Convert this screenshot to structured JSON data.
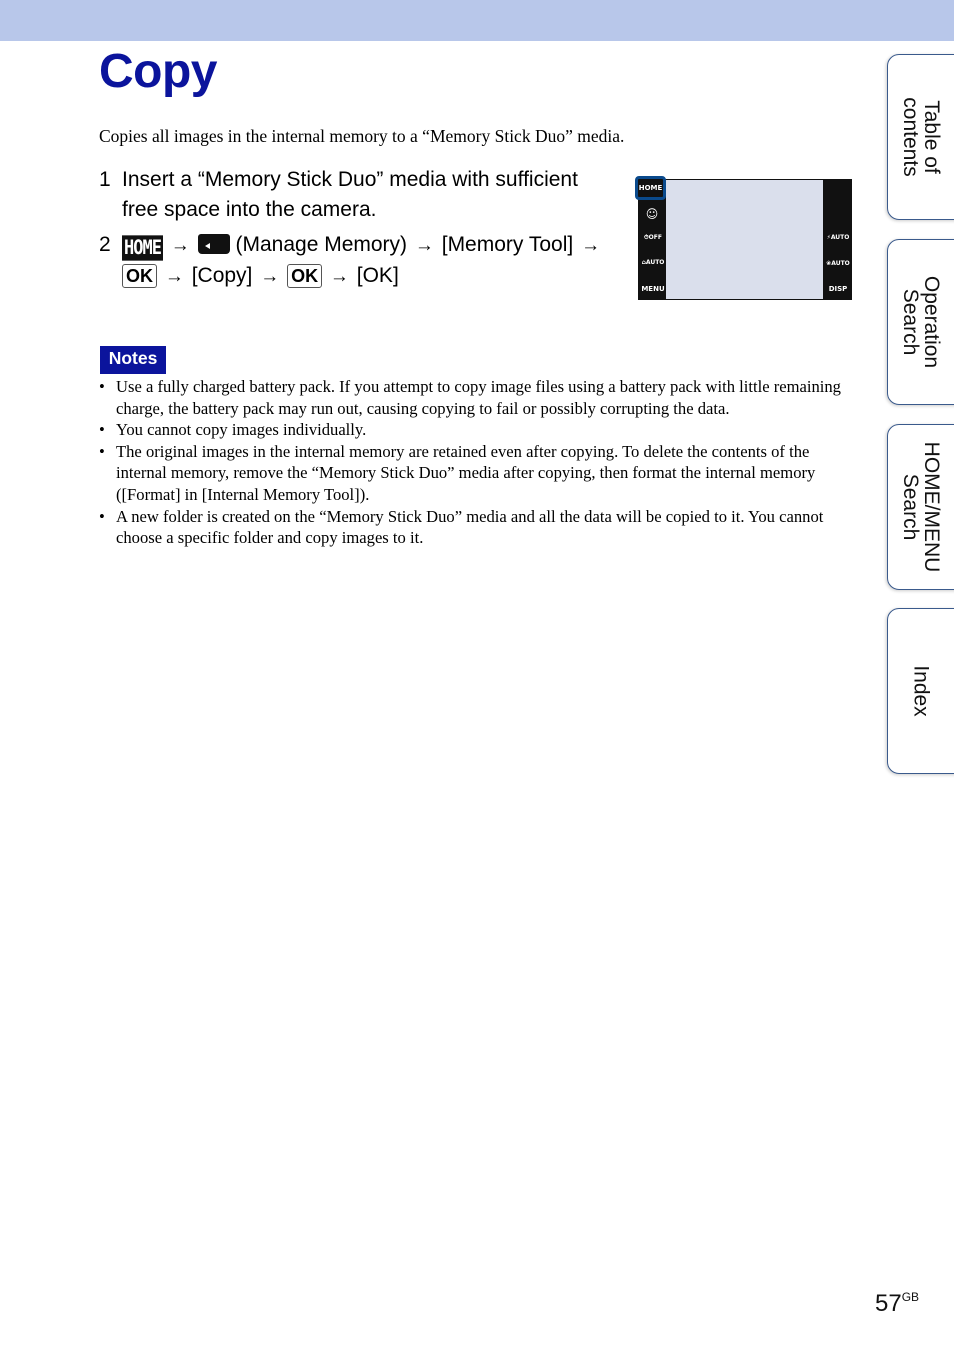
{
  "header": {
    "band_color": "#b8c7ea"
  },
  "page": {
    "title": "Copy",
    "intro": "Copies all images in the internal memory to a “Memory Stick Duo” media.",
    "steps": [
      {
        "number": "1",
        "text": "Insert a “Memory Stick Duo” media with sufficient free space into the camera."
      },
      {
        "number": "2",
        "home_icon": "HOME",
        "arrow": "→",
        "manage_memory_label": "(Manage Memory)",
        "memory_tool": "[Memory Tool]",
        "ok_icon": "OK",
        "copy": "[Copy]",
        "final": "[OK]"
      }
    ],
    "camera_screen": {
      "left_buttons": [
        "HOME",
        "face-icon",
        "self-timer-off-icon",
        "scene-auto-icon",
        "MENU"
      ],
      "left_labels": {
        "home": "HOME",
        "menu": "MENU",
        "timer": "⏱OFF",
        "scene": "⌂AUTO",
        "face": "☺"
      },
      "right_labels": {
        "flash": "⚡AUTO",
        "macro": "❀AUTO",
        "disp": "DISP"
      }
    },
    "notes": {
      "label": "Notes",
      "items": [
        "Use a fully charged battery pack. If you attempt to copy image files using a battery pack with little remaining charge, the battery pack may run out, causing copying to fail or possibly corrupting the data.",
        "You cannot copy images individually.",
        "The original images in the internal memory are retained even after copying. To delete the contents of the internal memory, remove the “Memory Stick Duo” media after copying, then format the internal memory ([Format] in [Internal Memory Tool]).",
        "A new folder is created on the “Memory Stick Duo” media and all the data will be copied to it. You cannot choose a specific folder and copy images to it."
      ]
    },
    "page_number": "57",
    "page_suffix": "GB"
  },
  "side_tabs": [
    {
      "line1": "Table of",
      "line2": "contents"
    },
    {
      "line1": "Operation",
      "line2": "Search"
    },
    {
      "line1": "HOME/MENU",
      "line2": "Search"
    },
    {
      "line1": "Index",
      "line2": ""
    }
  ],
  "colors": {
    "title": "#0b149c",
    "notes_bg": "#0b149c",
    "tab_border": "#3a5a8c"
  }
}
